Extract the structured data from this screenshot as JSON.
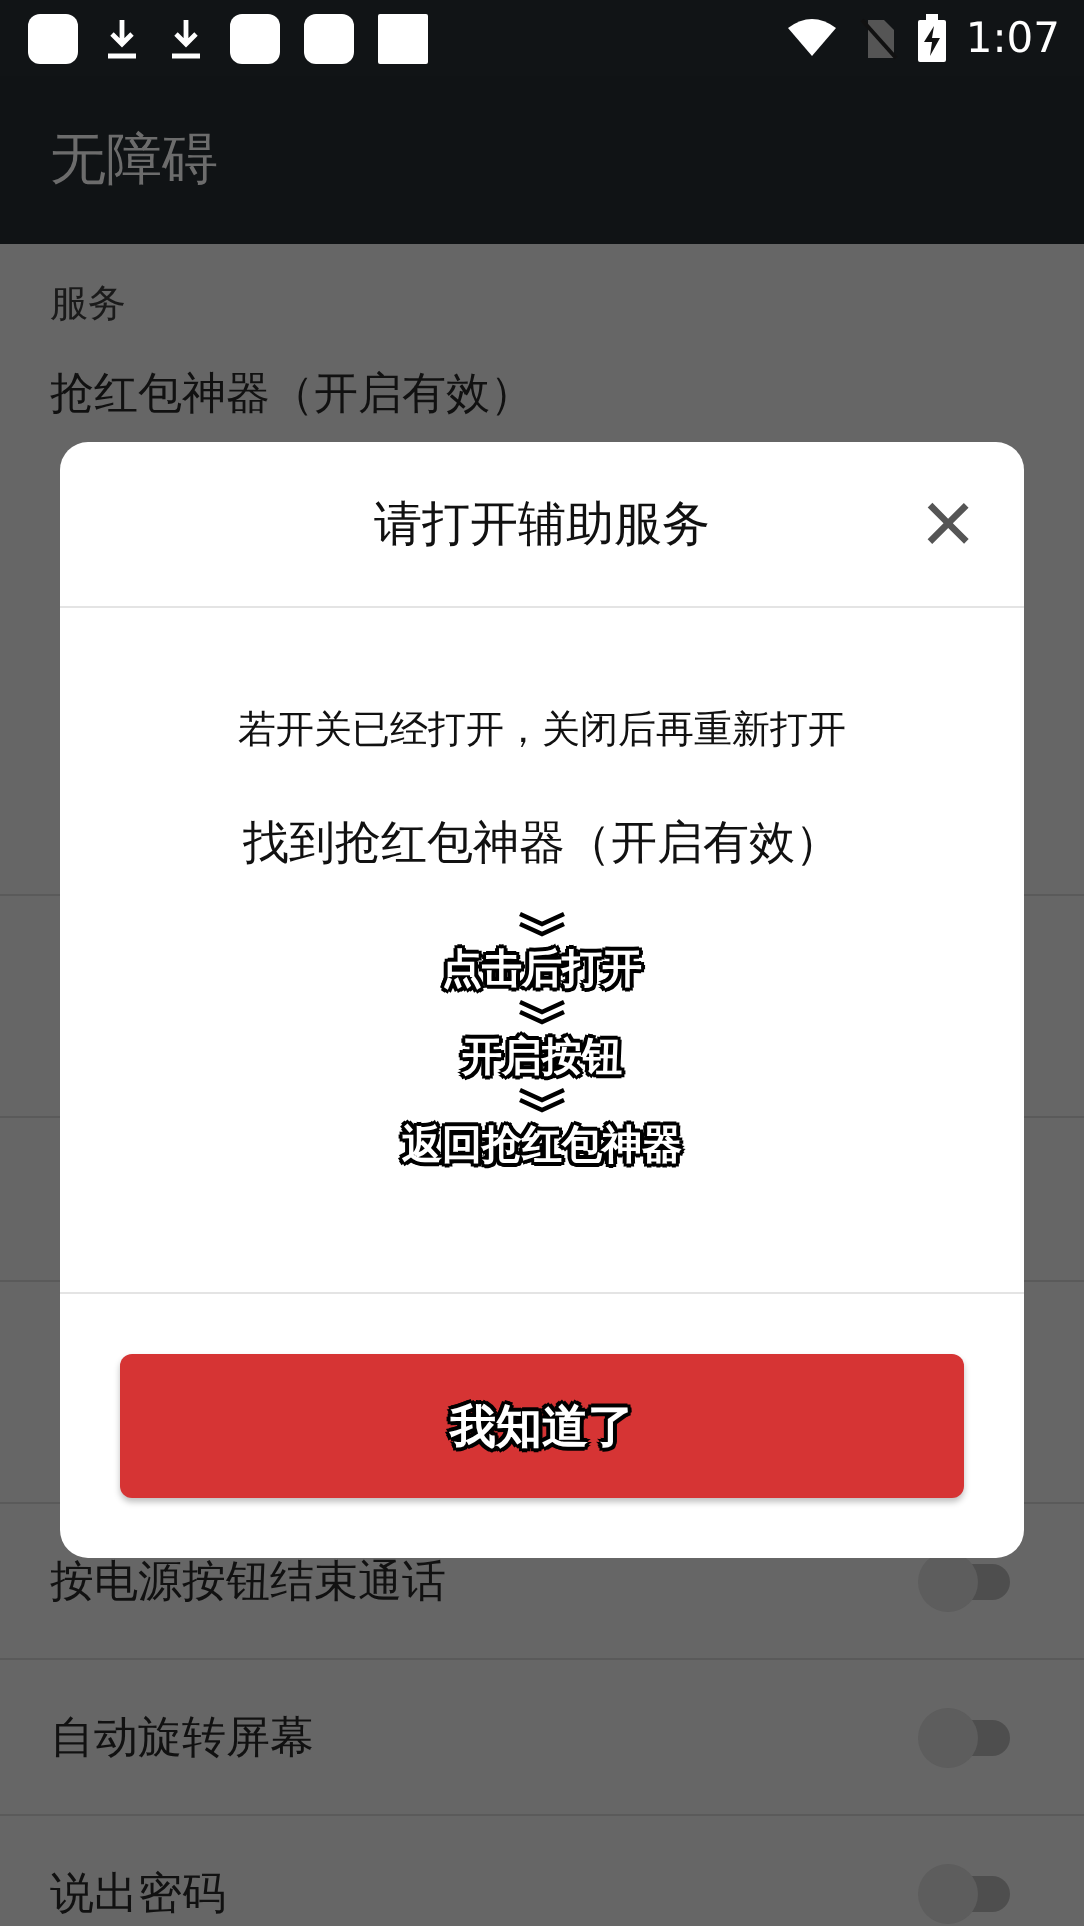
{
  "status_bar": {
    "time": "1:07"
  },
  "app_bar": {
    "title": "无障碍"
  },
  "settings": {
    "section": "服务",
    "items": [
      {
        "kind": "text",
        "title": "抢红包神器（开启有效）"
      },
      {
        "kind": "switch",
        "title": "按电源按钮结束通话",
        "on": false
      },
      {
        "kind": "switch",
        "title": "自动旋转屏幕",
        "on": false
      },
      {
        "kind": "switch",
        "title": "说出密码",
        "on": false
      }
    ]
  },
  "dialog": {
    "title": "请打开辅助服务",
    "close": "×",
    "note": "若开关已经打开，关闭后再重新打开",
    "target": "找到抢红包神器（开启有效）",
    "steps": [
      "点击后打开",
      "开启按钮",
      "返回抢红包神器"
    ],
    "button": "我知道了"
  }
}
